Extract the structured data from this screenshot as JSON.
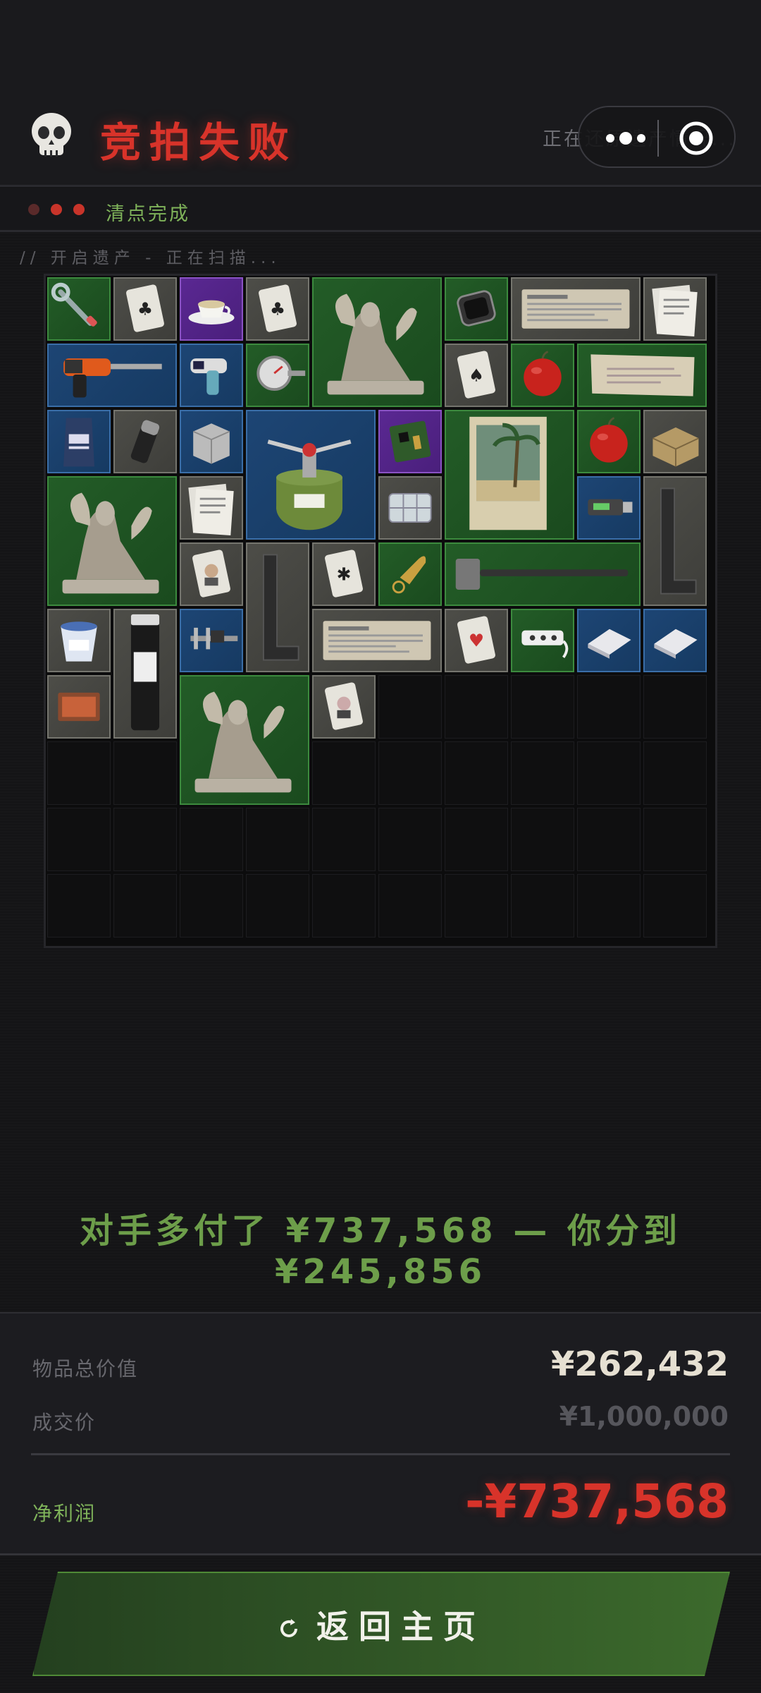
{
  "header": {
    "title": "竞拍失败",
    "restore_text": "正在还原遗产情况...",
    "skull_icon": "skull-icon"
  },
  "status": {
    "text": "清点完成",
    "dots": [
      "#5a2a2a",
      "#c8342a",
      "#c8342a"
    ]
  },
  "scan": {
    "text": "// 开启遗产 - 正在扫描..."
  },
  "inventory": {
    "columns": 10,
    "rows": 10,
    "items": [
      {
        "name": "wrench",
        "rarity": "green",
        "c": 0,
        "r": 0,
        "w": 1,
        "h": 1
      },
      {
        "name": "playing-card-clubs",
        "rarity": "gray",
        "c": 1,
        "r": 0,
        "w": 1,
        "h": 1
      },
      {
        "name": "teacup",
        "rarity": "purple",
        "c": 2,
        "r": 0,
        "w": 1,
        "h": 1
      },
      {
        "name": "playing-card-clubs",
        "rarity": "gray",
        "c": 3,
        "r": 0,
        "w": 1,
        "h": 1
      },
      {
        "name": "sphinx-statue",
        "rarity": "green",
        "c": 4,
        "r": 0,
        "w": 2,
        "h": 2
      },
      {
        "name": "smartwatch",
        "rarity": "green",
        "c": 6,
        "r": 0,
        "w": 1,
        "h": 1
      },
      {
        "name": "newspaper",
        "rarity": "gray",
        "c": 7,
        "r": 0,
        "w": 2,
        "h": 1
      },
      {
        "name": "paper-documents",
        "rarity": "gray",
        "c": 9,
        "r": 0,
        "w": 1,
        "h": 1
      },
      {
        "name": "power-drill",
        "rarity": "blue",
        "c": 0,
        "r": 1,
        "w": 2,
        "h": 1
      },
      {
        "name": "thermometer-gun",
        "rarity": "blue",
        "c": 2,
        "r": 1,
        "w": 1,
        "h": 1
      },
      {
        "name": "dial-gauge",
        "rarity": "green",
        "c": 3,
        "r": 1,
        "w": 1,
        "h": 1
      },
      {
        "name": "playing-card-spades",
        "rarity": "gray",
        "c": 6,
        "r": 1,
        "w": 1,
        "h": 1
      },
      {
        "name": "apple",
        "rarity": "green",
        "c": 7,
        "r": 1,
        "w": 1,
        "h": 1
      },
      {
        "name": "old-paper",
        "rarity": "green",
        "c": 8,
        "r": 1,
        "w": 2,
        "h": 1
      },
      {
        "name": "coffee-bag",
        "rarity": "blue",
        "c": 0,
        "r": 2,
        "w": 1,
        "h": 1
      },
      {
        "name": "grinder",
        "rarity": "gray",
        "c": 1,
        "r": 2,
        "w": 1,
        "h": 1
      },
      {
        "name": "metal-box",
        "rarity": "blue",
        "c": 2,
        "r": 2,
        "w": 1,
        "h": 1
      },
      {
        "name": "camping-stove",
        "rarity": "blue",
        "c": 3,
        "r": 2,
        "w": 2,
        "h": 2
      },
      {
        "name": "circuit-board",
        "rarity": "purple",
        "c": 5,
        "r": 2,
        "w": 1,
        "h": 1
      },
      {
        "name": "beach-poster",
        "rarity": "green",
        "c": 6,
        "r": 2,
        "w": 2,
        "h": 2
      },
      {
        "name": "apple",
        "rarity": "green",
        "c": 8,
        "r": 2,
        "w": 1,
        "h": 1
      },
      {
        "name": "cardboard-box",
        "rarity": "gray",
        "c": 9,
        "r": 2,
        "w": 1,
        "h": 1
      },
      {
        "name": "sphinx-statue",
        "rarity": "green",
        "c": 0,
        "r": 3,
        "w": 2,
        "h": 2
      },
      {
        "name": "paper-documents",
        "rarity": "gray",
        "c": 2,
        "r": 3,
        "w": 1,
        "h": 1
      },
      {
        "name": "pill-case",
        "rarity": "gray",
        "c": 5,
        "r": 3,
        "w": 1,
        "h": 1
      },
      {
        "name": "usb-drive",
        "rarity": "blue",
        "c": 8,
        "r": 3,
        "w": 1,
        "h": 1
      },
      {
        "name": "l-bracket",
        "rarity": "gray",
        "c": 9,
        "r": 3,
        "w": 1,
        "h": 2
      },
      {
        "name": "id-card",
        "rarity": "gray",
        "c": 2,
        "r": 4,
        "w": 1,
        "h": 1
      },
      {
        "name": "l-bracket",
        "rarity": "gray",
        "c": 3,
        "r": 4,
        "w": 1,
        "h": 2
      },
      {
        "name": "playing-card-special",
        "rarity": "gray",
        "c": 4,
        "r": 4,
        "w": 1,
        "h": 1
      },
      {
        "name": "bullet-keychain",
        "rarity": "green",
        "c": 5,
        "r": 4,
        "w": 1,
        "h": 1
      },
      {
        "name": "sledgehammer",
        "rarity": "green",
        "c": 6,
        "r": 4,
        "w": 3,
        "h": 1
      },
      {
        "name": "yogurt-cup",
        "rarity": "gray",
        "c": 0,
        "r": 5,
        "w": 1,
        "h": 1
      },
      {
        "name": "sample-bottle",
        "rarity": "gray",
        "c": 1,
        "r": 5,
        "w": 1,
        "h": 2
      },
      {
        "name": "caliper",
        "rarity": "blue",
        "c": 2,
        "r": 5,
        "w": 1,
        "h": 1
      },
      {
        "name": "newspaper",
        "rarity": "gray",
        "c": 4,
        "r": 5,
        "w": 2,
        "h": 1
      },
      {
        "name": "playing-card-hearts",
        "rarity": "gray",
        "c": 6,
        "r": 5,
        "w": 1,
        "h": 1
      },
      {
        "name": "power-strip",
        "rarity": "green",
        "c": 7,
        "r": 5,
        "w": 1,
        "h": 1
      },
      {
        "name": "napkin",
        "rarity": "blue",
        "c": 8,
        "r": 5,
        "w": 1,
        "h": 1
      },
      {
        "name": "napkin",
        "rarity": "blue",
        "c": 9,
        "r": 5,
        "w": 1,
        "h": 1
      },
      {
        "name": "matchbox",
        "rarity": "gray",
        "c": 0,
        "r": 6,
        "w": 1,
        "h": 1
      },
      {
        "name": "sphinx-statue",
        "rarity": "green",
        "c": 2,
        "r": 6,
        "w": 2,
        "h": 2
      },
      {
        "name": "playing-card-portrait",
        "rarity": "gray",
        "c": 4,
        "r": 6,
        "w": 1,
        "h": 1
      }
    ]
  },
  "result": {
    "line1": "对手多付了 ¥737,568 — 你分到",
    "line2": "¥245,856"
  },
  "summary": {
    "total_label": "物品总价值",
    "total_value": "¥262,432",
    "deal_label": "成交价",
    "deal_value": "¥1,000,000",
    "profit_label": "净利润",
    "profit_value": "-¥737,568"
  },
  "home_button": {
    "label": "返回主页",
    "icon": "refresh-icon"
  },
  "colors": {
    "danger": "#d8332a",
    "success": "#7fb35a",
    "result_green": "#6d9e4a",
    "profit_red": "#d8332a"
  }
}
